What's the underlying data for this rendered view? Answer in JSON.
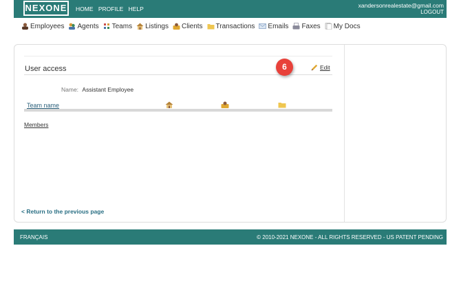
{
  "header": {
    "logo": "NEXONE",
    "nav": [
      "HOME",
      "PROFILE",
      "HELP"
    ],
    "user_email": "xandersonrealestate@gmail.com",
    "logout": "LOGOUT"
  },
  "main_menu": [
    {
      "label": "Employees",
      "icon": "employees-icon",
      "color": "#8b5a3c"
    },
    {
      "label": "Agents",
      "icon": "agents-icon",
      "color": "#d89a3a"
    },
    {
      "label": "Teams",
      "icon": "teams-icon",
      "color": "#c94e4e"
    },
    {
      "label": "Listings",
      "icon": "house-icon",
      "color": "#b5833a"
    },
    {
      "label": "Clients",
      "icon": "clients-icon",
      "color": "#e0a832"
    },
    {
      "label": "Transactions",
      "icon": "folder-icon",
      "color": "#efc650"
    },
    {
      "label": "Emails",
      "icon": "envelope-icon",
      "color": "#8aa6c8"
    },
    {
      "label": "Faxes",
      "icon": "fax-icon",
      "color": "#8a8a9a"
    },
    {
      "label": "My Docs",
      "icon": "docs-icon",
      "color": "#c8c8c8"
    }
  ],
  "section": {
    "title": "User access",
    "edit_label": "Edit",
    "step_badge": "6",
    "name_label": "Name:",
    "name_value": "Assistant Employee",
    "team_column": "Team name",
    "members_link": "Members",
    "back_link": "< Return to the previous page"
  },
  "footer": {
    "language": "FRANÇAIS",
    "copyright": "© 2010-2021 NEXONE - ALL RIGHTS RESERVED - US PATENT PENDING"
  },
  "colors": {
    "brand": "#2a7b77",
    "badge": "#e8413a",
    "link": "#2a6f84"
  }
}
